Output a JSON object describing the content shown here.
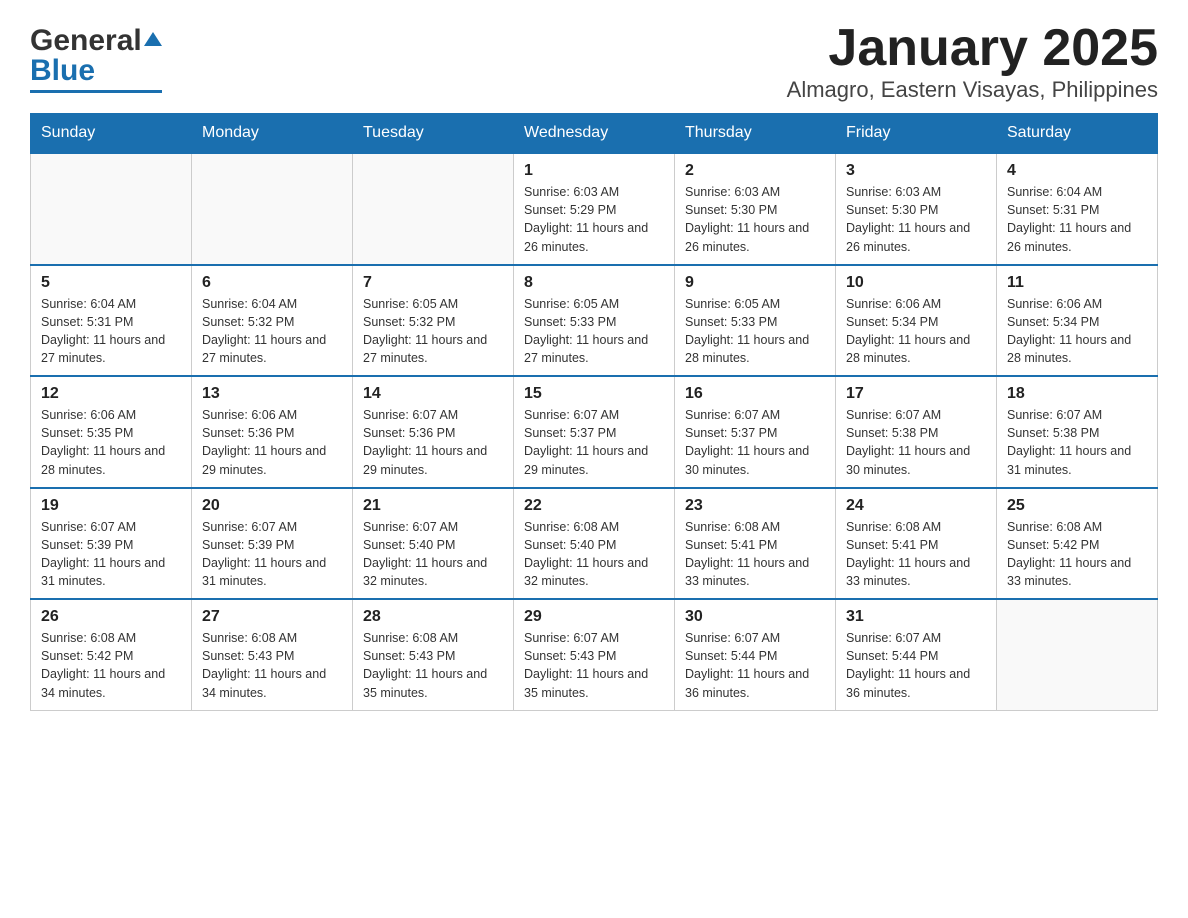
{
  "header": {
    "logo_general": "General",
    "logo_blue": "Blue",
    "title": "January 2025",
    "subtitle": "Almagro, Eastern Visayas, Philippines"
  },
  "days_of_week": [
    "Sunday",
    "Monday",
    "Tuesday",
    "Wednesday",
    "Thursday",
    "Friday",
    "Saturday"
  ],
  "weeks": [
    {
      "days": [
        {
          "num": "",
          "info": ""
        },
        {
          "num": "",
          "info": ""
        },
        {
          "num": "",
          "info": ""
        },
        {
          "num": "1",
          "info": "Sunrise: 6:03 AM\nSunset: 5:29 PM\nDaylight: 11 hours and 26 minutes."
        },
        {
          "num": "2",
          "info": "Sunrise: 6:03 AM\nSunset: 5:30 PM\nDaylight: 11 hours and 26 minutes."
        },
        {
          "num": "3",
          "info": "Sunrise: 6:03 AM\nSunset: 5:30 PM\nDaylight: 11 hours and 26 minutes."
        },
        {
          "num": "4",
          "info": "Sunrise: 6:04 AM\nSunset: 5:31 PM\nDaylight: 11 hours and 26 minutes."
        }
      ]
    },
    {
      "days": [
        {
          "num": "5",
          "info": "Sunrise: 6:04 AM\nSunset: 5:31 PM\nDaylight: 11 hours and 27 minutes."
        },
        {
          "num": "6",
          "info": "Sunrise: 6:04 AM\nSunset: 5:32 PM\nDaylight: 11 hours and 27 minutes."
        },
        {
          "num": "7",
          "info": "Sunrise: 6:05 AM\nSunset: 5:32 PM\nDaylight: 11 hours and 27 minutes."
        },
        {
          "num": "8",
          "info": "Sunrise: 6:05 AM\nSunset: 5:33 PM\nDaylight: 11 hours and 27 minutes."
        },
        {
          "num": "9",
          "info": "Sunrise: 6:05 AM\nSunset: 5:33 PM\nDaylight: 11 hours and 28 minutes."
        },
        {
          "num": "10",
          "info": "Sunrise: 6:06 AM\nSunset: 5:34 PM\nDaylight: 11 hours and 28 minutes."
        },
        {
          "num": "11",
          "info": "Sunrise: 6:06 AM\nSunset: 5:34 PM\nDaylight: 11 hours and 28 minutes."
        }
      ]
    },
    {
      "days": [
        {
          "num": "12",
          "info": "Sunrise: 6:06 AM\nSunset: 5:35 PM\nDaylight: 11 hours and 28 minutes."
        },
        {
          "num": "13",
          "info": "Sunrise: 6:06 AM\nSunset: 5:36 PM\nDaylight: 11 hours and 29 minutes."
        },
        {
          "num": "14",
          "info": "Sunrise: 6:07 AM\nSunset: 5:36 PM\nDaylight: 11 hours and 29 minutes."
        },
        {
          "num": "15",
          "info": "Sunrise: 6:07 AM\nSunset: 5:37 PM\nDaylight: 11 hours and 29 minutes."
        },
        {
          "num": "16",
          "info": "Sunrise: 6:07 AM\nSunset: 5:37 PM\nDaylight: 11 hours and 30 minutes."
        },
        {
          "num": "17",
          "info": "Sunrise: 6:07 AM\nSunset: 5:38 PM\nDaylight: 11 hours and 30 minutes."
        },
        {
          "num": "18",
          "info": "Sunrise: 6:07 AM\nSunset: 5:38 PM\nDaylight: 11 hours and 31 minutes."
        }
      ]
    },
    {
      "days": [
        {
          "num": "19",
          "info": "Sunrise: 6:07 AM\nSunset: 5:39 PM\nDaylight: 11 hours and 31 minutes."
        },
        {
          "num": "20",
          "info": "Sunrise: 6:07 AM\nSunset: 5:39 PM\nDaylight: 11 hours and 31 minutes."
        },
        {
          "num": "21",
          "info": "Sunrise: 6:07 AM\nSunset: 5:40 PM\nDaylight: 11 hours and 32 minutes."
        },
        {
          "num": "22",
          "info": "Sunrise: 6:08 AM\nSunset: 5:40 PM\nDaylight: 11 hours and 32 minutes."
        },
        {
          "num": "23",
          "info": "Sunrise: 6:08 AM\nSunset: 5:41 PM\nDaylight: 11 hours and 33 minutes."
        },
        {
          "num": "24",
          "info": "Sunrise: 6:08 AM\nSunset: 5:41 PM\nDaylight: 11 hours and 33 minutes."
        },
        {
          "num": "25",
          "info": "Sunrise: 6:08 AM\nSunset: 5:42 PM\nDaylight: 11 hours and 33 minutes."
        }
      ]
    },
    {
      "days": [
        {
          "num": "26",
          "info": "Sunrise: 6:08 AM\nSunset: 5:42 PM\nDaylight: 11 hours and 34 minutes."
        },
        {
          "num": "27",
          "info": "Sunrise: 6:08 AM\nSunset: 5:43 PM\nDaylight: 11 hours and 34 minutes."
        },
        {
          "num": "28",
          "info": "Sunrise: 6:08 AM\nSunset: 5:43 PM\nDaylight: 11 hours and 35 minutes."
        },
        {
          "num": "29",
          "info": "Sunrise: 6:07 AM\nSunset: 5:43 PM\nDaylight: 11 hours and 35 minutes."
        },
        {
          "num": "30",
          "info": "Sunrise: 6:07 AM\nSunset: 5:44 PM\nDaylight: 11 hours and 36 minutes."
        },
        {
          "num": "31",
          "info": "Sunrise: 6:07 AM\nSunset: 5:44 PM\nDaylight: 11 hours and 36 minutes."
        },
        {
          "num": "",
          "info": ""
        }
      ]
    }
  ]
}
